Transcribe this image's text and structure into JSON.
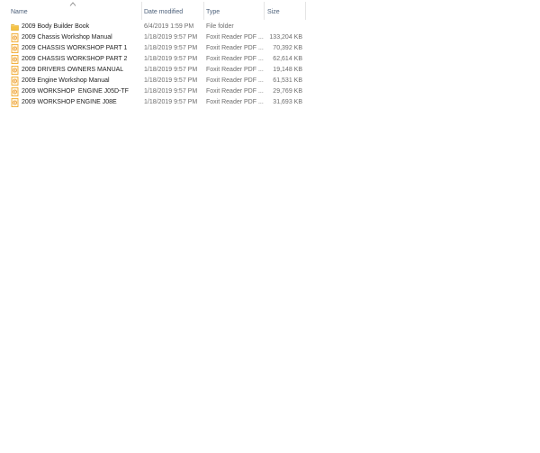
{
  "header": {
    "name": "Name",
    "date_modified": "Date modified",
    "type": "Type",
    "size": "Size",
    "sort_icon": "sort-up-chevron"
  },
  "rows": [
    {
      "name": "2009 Body Builder Book",
      "date": "6/4/2019 1:59 PM",
      "type": "File folder",
      "size": "",
      "icon": "folder-icon"
    },
    {
      "name": "2009 Chassis Workshop Manual",
      "date": "1/18/2019 9:57 PM",
      "type": "Foxit Reader PDF ...",
      "size": "133,204 KB",
      "icon": "pdf-file-icon"
    },
    {
      "name": "2009 CHASSIS WORKSHOP PART 1",
      "date": "1/18/2019 9:57 PM",
      "type": "Foxit Reader PDF ...",
      "size": "70,392 KB",
      "icon": "pdf-file-icon"
    },
    {
      "name": "2009 CHASSIS WORKSHOP PART 2",
      "date": "1/18/2019 9:57 PM",
      "type": "Foxit Reader PDF ...",
      "size": "62,614 KB",
      "icon": "pdf-file-icon"
    },
    {
      "name": "2009 DRIVERS OWNERS MANUAL",
      "date": "1/18/2019 9:57 PM",
      "type": "Foxit Reader PDF ...",
      "size": "19,148 KB",
      "icon": "pdf-file-icon"
    },
    {
      "name": "2009 Engine Workshop Manual",
      "date": "1/18/2019 9:57 PM",
      "type": "Foxit Reader PDF ...",
      "size": "61,531 KB",
      "icon": "pdf-file-icon"
    },
    {
      "name": "2009 WORKSHOP  ENGINE J05D-TF",
      "date": "1/18/2019 9:57 PM",
      "type": "Foxit Reader PDF ...",
      "size": "29,769 KB",
      "icon": "pdf-file-icon"
    },
    {
      "name": "2009 WORKSHOP ENGINE J08E",
      "date": "1/18/2019 9:57 PM",
      "type": "Foxit Reader PDF ...",
      "size": "31,693 KB",
      "icon": "pdf-file-icon"
    }
  ],
  "colors": {
    "header_text": "#4c607a",
    "name_text": "#1e1e1e",
    "detail_text": "#6d6d6d",
    "folder": "#f5c243",
    "pdf_icon": "#f0a31c"
  }
}
